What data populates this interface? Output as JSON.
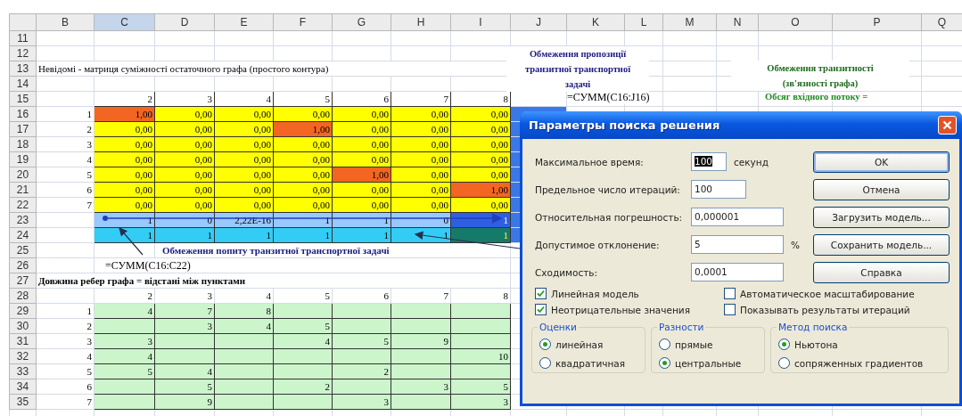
{
  "sheet": {
    "columns": [
      {
        "label": "B",
        "selected": false
      },
      {
        "label": "C",
        "selected": true
      },
      {
        "label": "D",
        "selected": false
      },
      {
        "label": "E",
        "selected": false
      },
      {
        "label": "F",
        "selected": false
      },
      {
        "label": "G",
        "selected": false
      },
      {
        "label": "H",
        "selected": false
      },
      {
        "label": "I",
        "selected": false
      },
      {
        "label": "J",
        "selected": false
      },
      {
        "label": "K",
        "selected": false
      },
      {
        "label": "L",
        "selected": false
      },
      {
        "label": "M",
        "selected": false
      },
      {
        "label": "N",
        "selected": false
      },
      {
        "label": "O",
        "selected": false
      },
      {
        "label": "P",
        "selected": false
      },
      {
        "label": "Q",
        "selected": false
      }
    ],
    "rows": [
      {
        "num": "11",
        "kind": "blank"
      },
      {
        "num": "12",
        "kind": "blank"
      },
      {
        "num": "13",
        "kind": "note",
        "text": "Невідомі - матриця суміжності остаточного графа (простого контура)"
      },
      {
        "num": "14",
        "kind": "blank"
      },
      {
        "num": "15",
        "kind": "header_boxed",
        "cells": [
          "2",
          "3",
          "4",
          "5",
          "6",
          "7",
          "8"
        ]
      },
      {
        "num": "16",
        "kind": "matrix",
        "label": "1",
        "cells": [
          {
            "value": "1,00",
            "highlighted": true
          },
          {
            "value": "0,00",
            "highlighted": false
          },
          {
            "value": "0,00",
            "highlighted": false
          },
          {
            "value": "0,00",
            "highlighted": false
          },
          {
            "value": "0,00",
            "highlighted": false
          },
          {
            "value": "0,00",
            "highlighted": false
          },
          {
            "value": "0,00",
            "highlighted": false
          }
        ]
      },
      {
        "num": "17",
        "kind": "matrix",
        "label": "2",
        "cells": [
          {
            "value": "0,00",
            "highlighted": false
          },
          {
            "value": "0,00",
            "highlighted": false
          },
          {
            "value": "0,00",
            "highlighted": false
          },
          {
            "value": "1,00",
            "highlighted": true
          },
          {
            "value": "0,00",
            "highlighted": false
          },
          {
            "value": "0,00",
            "highlighted": false
          },
          {
            "value": "0,00",
            "highlighted": false
          }
        ]
      },
      {
        "num": "18",
        "kind": "matrix",
        "label": "3",
        "cells": [
          {
            "value": "0,00",
            "highlighted": false
          },
          {
            "value": "0,00",
            "highlighted": false
          },
          {
            "value": "0,00",
            "highlighted": false
          },
          {
            "value": "0,00",
            "highlighted": false
          },
          {
            "value": "0,00",
            "highlighted": false
          },
          {
            "value": "0,00",
            "highlighted": false
          },
          {
            "value": "0,00",
            "highlighted": false
          }
        ]
      },
      {
        "num": "19",
        "kind": "matrix",
        "label": "4",
        "cells": [
          {
            "value": "0,00",
            "highlighted": false
          },
          {
            "value": "0,00",
            "highlighted": false
          },
          {
            "value": "0,00",
            "highlighted": false
          },
          {
            "value": "0,00",
            "highlighted": false
          },
          {
            "value": "0,00",
            "highlighted": false
          },
          {
            "value": "0,00",
            "highlighted": false
          },
          {
            "value": "0,00",
            "highlighted": false
          }
        ]
      },
      {
        "num": "20",
        "kind": "matrix",
        "label": "5",
        "cells": [
          {
            "value": "0,00",
            "highlighted": false
          },
          {
            "value": "0,00",
            "highlighted": false
          },
          {
            "value": "0,00",
            "highlighted": false
          },
          {
            "value": "0,00",
            "highlighted": false
          },
          {
            "value": "1,00",
            "highlighted": true
          },
          {
            "value": "0,00",
            "highlighted": false
          },
          {
            "value": "0,00",
            "highlighted": false
          }
        ]
      },
      {
        "num": "21",
        "kind": "matrix",
        "label": "6",
        "cells": [
          {
            "value": "0,00",
            "highlighted": false
          },
          {
            "value": "0,00",
            "highlighted": false
          },
          {
            "value": "0,00",
            "highlighted": false
          },
          {
            "value": "0,00",
            "highlighted": false
          },
          {
            "value": "0,00",
            "highlighted": false
          },
          {
            "value": "0,00",
            "highlighted": false
          },
          {
            "value": "1,00",
            "highlighted": true
          }
        ]
      },
      {
        "num": "22",
        "kind": "matrix",
        "label": "7",
        "cells": [
          {
            "value": "0,00",
            "highlighted": false
          },
          {
            "value": "0,00",
            "highlighted": false
          },
          {
            "value": "0,00",
            "highlighted": false
          },
          {
            "value": "0,00",
            "highlighted": false
          },
          {
            "value": "0,00",
            "highlighted": false
          },
          {
            "value": "0,00",
            "highlighted": false
          },
          {
            "value": "0,00",
            "highlighted": false
          }
        ]
      },
      {
        "num": "23",
        "kind": "sum",
        "cells": [
          {
            "value": "1",
            "highlighted": false
          },
          {
            "value": "0",
            "highlighted": false
          },
          {
            "value": "2,22E-16",
            "highlighted": false
          },
          {
            "value": "1",
            "highlighted": false
          },
          {
            "value": "1",
            "highlighted": false
          },
          {
            "value": "0",
            "highlighted": false
          },
          {
            "value": "1",
            "highlighted": true
          }
        ]
      },
      {
        "num": "24",
        "kind": "limit",
        "cells": [
          {
            "value": "1",
            "highlighted": false
          },
          {
            "value": "1",
            "highlighted": false
          },
          {
            "value": "1",
            "highlighted": false
          },
          {
            "value": "1",
            "highlighted": false
          },
          {
            "value": "1",
            "highlighted": false
          },
          {
            "value": "1",
            "highlighted": false
          },
          {
            "value": "1",
            "highlighted": true
          }
        ]
      },
      {
        "num": "25",
        "kind": "caption",
        "text": "Обмеження попиту транзитної транспортної задачі"
      },
      {
        "num": "26",
        "kind": "formula",
        "text": "=СУММ(C16:C22)"
      },
      {
        "num": "27",
        "kind": "title",
        "text": "Довжина ребер графа = відстані між пунктами"
      },
      {
        "num": "28",
        "kind": "header_plain",
        "cells": [
          "2",
          "3",
          "4",
          "5",
          "6",
          "7",
          "8"
        ]
      },
      {
        "num": "29",
        "kind": "distance",
        "label": "1",
        "cells": [
          "4",
          "7",
          "8",
          null,
          null,
          null,
          null
        ]
      },
      {
        "num": "30",
        "kind": "distance",
        "label": "2",
        "cells": [
          null,
          "3",
          "4",
          "5",
          null,
          null,
          null
        ]
      },
      {
        "num": "31",
        "kind": "distance",
        "label": "3",
        "cells": [
          "3",
          null,
          null,
          "4",
          "5",
          "9",
          null
        ]
      },
      {
        "num": "32",
        "kind": "distance",
        "label": "4",
        "cells": [
          "4",
          null,
          null,
          null,
          null,
          null,
          "10"
        ]
      },
      {
        "num": "33",
        "kind": "distance",
        "label": "5",
        "cells": [
          "5",
          "4",
          null,
          null,
          "2",
          null,
          null
        ]
      },
      {
        "num": "34",
        "kind": "distance",
        "label": "6",
        "cells": [
          null,
          "5",
          null,
          "2",
          null,
          "3",
          "5"
        ]
      },
      {
        "num": "35",
        "kind": "distance",
        "label": "7",
        "cells": [
          null,
          "9",
          null,
          null,
          "3",
          null,
          "3"
        ]
      }
    ],
    "supply_note": [
      "Обмеження пропозиції",
      "транзитної транспортної",
      "задачі"
    ],
    "supply_formula": "=СУММ(C16:J16)",
    "transit_note": [
      "Обмеження транзитності",
      "(зв'язності графа)"
    ],
    "inflow_label": "Обсяг вхідного потоку ="
  },
  "dialog": {
    "title": "Параметры поиска решения",
    "fields": [
      {
        "label": "Максимальное время:",
        "value": "100",
        "text_selected": true,
        "unit": "секунд"
      },
      {
        "label": "Предельное число итераций:",
        "value": "100",
        "text_selected": false
      },
      {
        "label": "Относительная погрешность:",
        "value": "0,000001",
        "text_selected": false
      },
      {
        "label": "Допустимое отклонение:",
        "value": "5",
        "text_selected": false,
        "unit": "%"
      },
      {
        "label": "Сходимость:",
        "value": "0,0001",
        "text_selected": false
      }
    ],
    "buttons": [
      {
        "label": "OK",
        "default": true
      },
      {
        "label": "Отмена",
        "default": false
      },
      {
        "label": "Загрузить модель...",
        "default": false
      },
      {
        "label": "Сохранить модель...",
        "default": false
      },
      {
        "label": "Справка",
        "default": false
      }
    ],
    "checkboxes": [
      {
        "label": "Линейная модель",
        "checked": true
      },
      {
        "label": "Автоматическое масштабирование",
        "checked": false
      },
      {
        "label": "Неотрицательные значения",
        "checked": true
      },
      {
        "label": "Показывать результаты итераций",
        "checked": false
      }
    ],
    "groups": [
      {
        "title": "Оценки",
        "options": [
          {
            "label": "линейная",
            "selected": true
          },
          {
            "label": "квадратичная",
            "selected": false
          }
        ]
      },
      {
        "title": "Разности",
        "options": [
          {
            "label": "прямые",
            "selected": false
          },
          {
            "label": "центральные",
            "selected": true
          }
        ]
      },
      {
        "title": "Метод поиска",
        "options": [
          {
            "label": "Ньютона",
            "selected": true
          },
          {
            "label": "сопряженных градиентов",
            "selected": false
          }
        ]
      }
    ]
  }
}
